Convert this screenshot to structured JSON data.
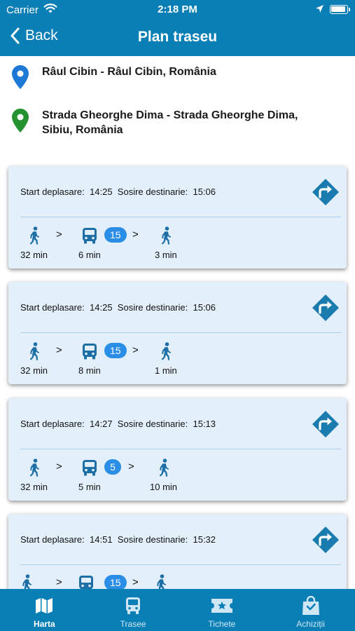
{
  "status_bar": {
    "carrier": "Carrier",
    "time": "2:18 PM"
  },
  "nav": {
    "back_label": "Back",
    "title": "Plan traseu"
  },
  "locations": {
    "origin": "Râul Cibin - Râul Cibin, România",
    "destination": "Strada Gheorghe Dima - Strada Gheorghe Dima, Sibiu, România",
    "origin_pin_color": "#1e78d6",
    "destination_pin_color": "#23922f"
  },
  "labels": {
    "start": "Start deplasare:",
    "arrival": "Sosire destinarie:"
  },
  "routes": [
    {
      "start": "14:25",
      "arrival": "15:06",
      "walk1": "32 min",
      "bus": "6 min",
      "line": "15",
      "walk2": "3 min"
    },
    {
      "start": "14:25",
      "arrival": "15:06",
      "walk1": "32 min",
      "bus": "8 min",
      "line": "15",
      "walk2": "1 min"
    },
    {
      "start": "14:27",
      "arrival": "15:13",
      "walk1": "32 min",
      "bus": "5 min",
      "line": "5",
      "walk2": "10 min"
    },
    {
      "start": "14:51",
      "arrival": "15:32",
      "walk1": "",
      "bus": "",
      "line": "15",
      "walk2": ""
    }
  ],
  "tabs": [
    {
      "label": "Harta",
      "icon": "map-icon",
      "active": true
    },
    {
      "label": "Trasee",
      "icon": "bus-icon",
      "active": false
    },
    {
      "label": "Tichete",
      "icon": "ticket-icon",
      "active": false
    },
    {
      "label": "Achiziții",
      "icon": "shopping-bag-icon",
      "active": false
    }
  ],
  "colors": {
    "primary": "#0a7fb5",
    "card_bg": "#e3f0fc",
    "icon_blue": "#1d6fa5",
    "badge_blue": "#2a8ee6"
  }
}
